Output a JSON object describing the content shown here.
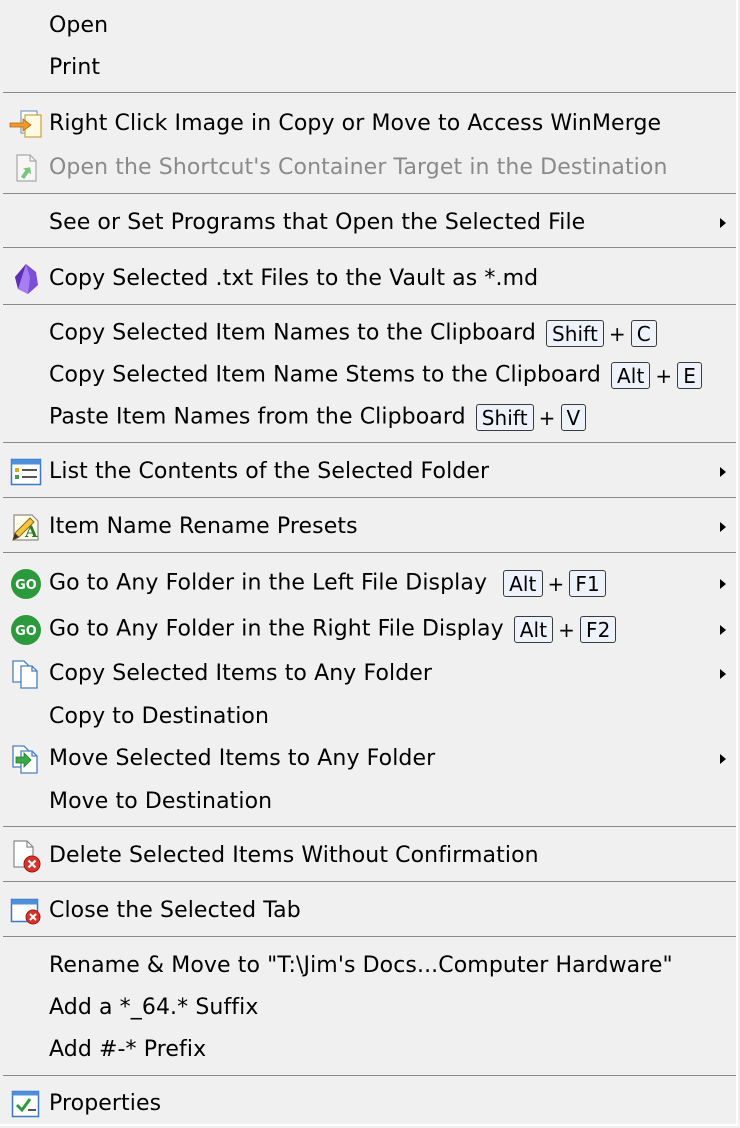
{
  "menu": {
    "open": "Open",
    "print": "Print",
    "winmerge": "Right Click Image in Copy or Move to Access WinMerge",
    "open_shortcut_target": "Open the Shortcut's Container Target in the Destination",
    "see_programs": "See or Set Programs that Open the Selected File",
    "copy_txt_vault": "Copy Selected .txt Files to the Vault as *.md",
    "copy_names": "Copy Selected Item Names to the Clipboard",
    "copy_names_keys": [
      "Shift",
      "C"
    ],
    "copy_stems": "Copy Selected Item Name Stems to the Clipboard",
    "copy_stems_keys": [
      "Alt",
      "E"
    ],
    "paste_names": "Paste Item Names from the Clipboard",
    "paste_names_keys": [
      "Shift",
      "V"
    ],
    "list_contents": "List the Contents of the Selected Folder",
    "rename_presets": "Item Name Rename Presets",
    "goto_left": "Go to Any Folder in the Left File Display",
    "goto_left_keys": [
      "Alt",
      "F1"
    ],
    "goto_right": "Go to Any Folder in the Right File Display",
    "goto_right_keys": [
      "Alt",
      "F2"
    ],
    "copy_any": "Copy Selected Items to Any Folder",
    "copy_dest": "Copy to Destination",
    "move_any": "Move Selected Items to Any Folder",
    "move_dest": "Move to Destination",
    "delete_no_confirm": "Delete Selected Items Without Confirmation",
    "close_tab": "Close the Selected Tab",
    "rename_move": "Rename & Move to \"T:\\Jim's Docs...Computer Hardware\"",
    "add_suffix": "Add a *_64.* Suffix",
    "add_prefix": "Add #-* Prefix",
    "properties": "Properties",
    "plus": "+",
    "go_icon_text": "GO"
  },
  "colors": {
    "background": "#f0f0f0",
    "separator": "#8a8a8a",
    "disabled_text": "#8a8a8a",
    "go_icon": "#2c9a3c",
    "key_border": "#3b3b3b"
  }
}
